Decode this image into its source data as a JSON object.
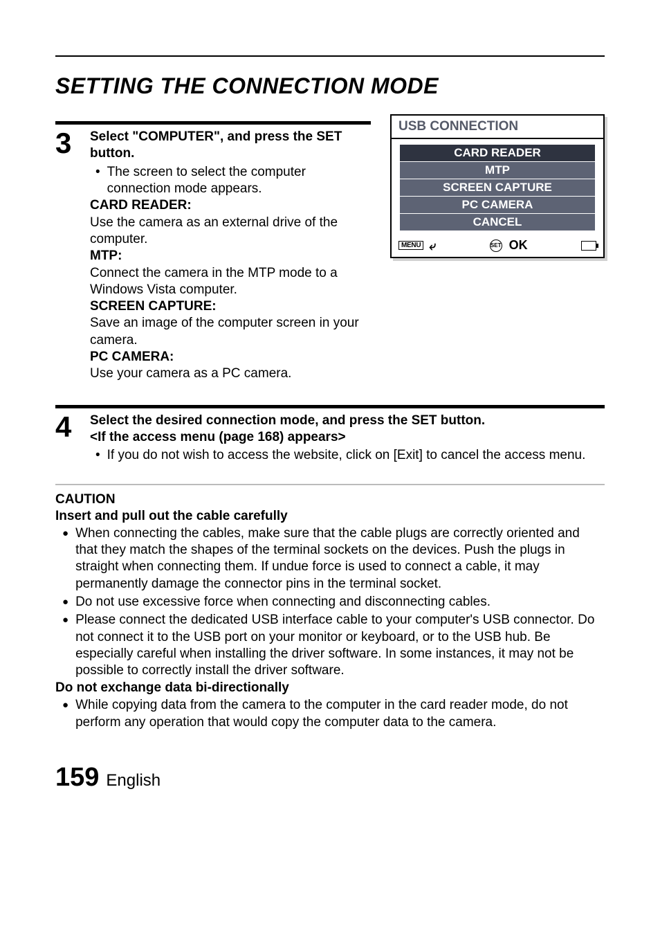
{
  "page": {
    "title": "SETTING THE CONNECTION MODE",
    "number": "159",
    "language": "English"
  },
  "step3": {
    "number": "3",
    "title": "Select \"COMPUTER\", and press the SET button.",
    "bullet": "The screen to select the computer connection mode appears.",
    "defs": [
      {
        "label": "CARD READER:",
        "text": "Use the camera as an external drive of the computer."
      },
      {
        "label": "MTP:",
        "text": "Connect the camera in the MTP mode to a Windows Vista computer."
      },
      {
        "label": "SCREEN CAPTURE:",
        "text": "Save an image of the computer screen in your camera."
      },
      {
        "label": "PC CAMERA:",
        "text": "Use your camera as a PC camera."
      }
    ]
  },
  "ui": {
    "title": "USB CONNECTION",
    "options": [
      "CARD READER",
      "MTP",
      "SCREEN CAPTURE",
      "PC CAMERA",
      "CANCEL"
    ],
    "menu_badge": "MENU",
    "set_badge": "SET",
    "ok": "OK"
  },
  "step4": {
    "number": "4",
    "title_a": "Select the desired connection mode, and press the SET button.",
    "title_b": "<If the access menu (page 168) appears>",
    "bullet": "If you do not wish to access the website, click on [Exit] to cancel the access menu."
  },
  "caution": {
    "heading": "CAUTION",
    "sub1": "Insert and pull out the cable carefully",
    "items1": [
      "When connecting the cables, make sure that the cable plugs are correctly oriented and that they match the shapes of the terminal sockets on the devices. Push the plugs in straight when connecting them. If undue force is used to connect a cable, it may permanently damage the connector pins in the terminal socket.",
      "Do not use excessive force when connecting and disconnecting cables.",
      "Please connect the dedicated USB interface cable to your computer's USB connector. Do not connect it to the USB port on your monitor or keyboard, or to the USB hub. Be especially careful when installing the driver software. In some instances, it may not be possible to correctly install the driver software."
    ],
    "sub2": "Do not exchange data bi-directionally",
    "items2": [
      "While copying data from the camera to the computer in the card reader mode, do not perform any operation that would copy the computer data to the camera."
    ]
  }
}
